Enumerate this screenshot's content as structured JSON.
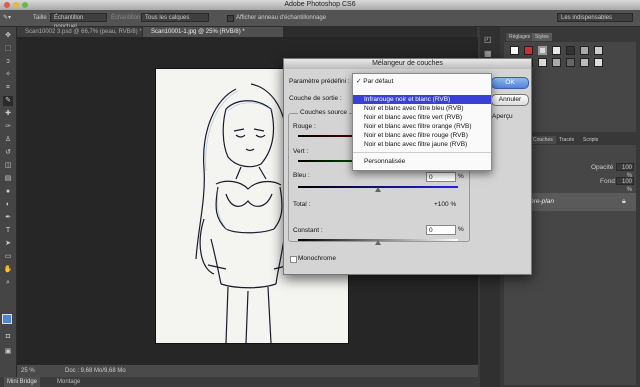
{
  "app": {
    "title": "Adobe Photoshop CS6"
  },
  "options_bar": {
    "size_label": "Taille :",
    "sample_dropdown": "Échantillon ponctuel",
    "sample_label": "Échantillon :",
    "sample_value": "Tous les calques",
    "show_ring_label": "Afficher anneau d'échantillonnage",
    "workspace": "Les indispensables"
  },
  "tabs": [
    {
      "label": "Scan10002 3.psd @ 66,7% (peau, RVB/8) *"
    },
    {
      "label": "Scan10001-1.jpg @ 25% (RVB/8) *"
    }
  ],
  "status": {
    "zoom": "25 %",
    "doc": "Doc : 9,68 Mo/9,68 Mo"
  },
  "bottom_tabs": [
    "Mini Bridge",
    "Montage"
  ],
  "right_panel": {
    "tabs": [
      "Réglages",
      "Styles"
    ],
    "layer_tabs": [
      "Couches",
      "Tracés",
      "Scripts"
    ],
    "opacity_label": "Opacité :",
    "opacity_value": "100 %",
    "fill_label": "Fond :",
    "fill_value": "100 %",
    "layer_name": "Arrière-plan"
  },
  "dialog": {
    "title": "Mélangeur de couches",
    "preset_label": "Paramètre prédéfini :",
    "output_label": "Couche de sortie :",
    "source_group": "Couches source",
    "red_label": "Rouge :",
    "green_label": "Vert :",
    "blue_label": "Bleu :",
    "blue_value": "0",
    "total_label": "Total :",
    "total_value": "+100 %",
    "constant_label": "Constant :",
    "constant_value": "0",
    "pct": "%",
    "monochrome_label": "Monochrome",
    "ok_label": "OK",
    "cancel_label": "Annuler",
    "preview_label": "Aperçu",
    "blue_level": 0.5,
    "constant_level": 0.5,
    "preset_menu": {
      "checked": "Par défaut",
      "items": [
        "Infrarouge noir et blanc (RVB)",
        "Noir et blanc avec filtre bleu (RVB)",
        "Noir et blanc avec filtre vert (RVB)",
        "Noir et blanc avec filtre orange (RVB)",
        "Noir et blanc avec filtre rouge (RVB)",
        "Noir et blanc avec filtre jaune (RVB)"
      ],
      "custom": "Personnalisée",
      "selected_index": 0
    }
  },
  "colors": {
    "highlight": "#3a3fd6",
    "accent": "#4f84d8"
  }
}
